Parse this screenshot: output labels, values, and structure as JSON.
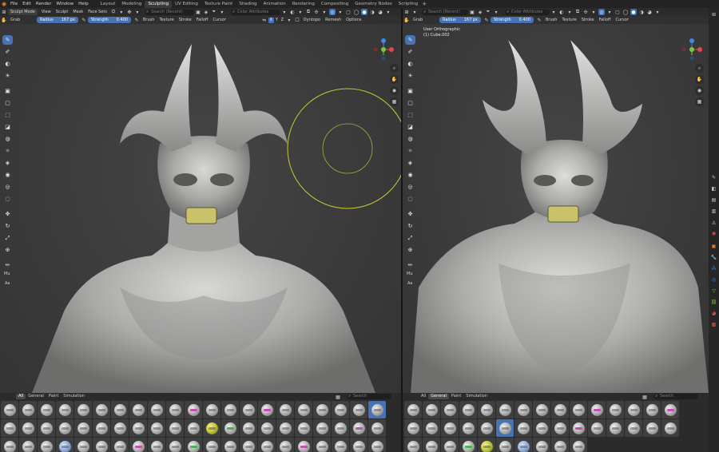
{
  "topbar": {
    "menus": [
      "File",
      "Edit",
      "Render",
      "Window",
      "Help"
    ],
    "workspaces": [
      "Layout",
      "Modeling",
      "Sculpting",
      "UV Editing",
      "Texture Paint",
      "Shading",
      "Animation",
      "Rendering",
      "Compositing",
      "Geometry Nodes",
      "Scripting"
    ],
    "active_workspace": "Sculpting",
    "add_tab": "+"
  },
  "left": {
    "header1": {
      "mode": "Sculpt Mode",
      "menus": [
        "View",
        "Sculpt",
        "Mask",
        "Face Sets"
      ],
      "search_placeholder": "Search (Recent)",
      "color_attributes": "Color Attributes"
    },
    "header2": {
      "tool": "Grab",
      "radius_label": "Radius",
      "radius_value": "167 px",
      "strength_label": "Strength",
      "strength_value": "0.400",
      "menus": [
        "Brush",
        "Texture",
        "Stroke",
        "Falloff",
        "Cursor"
      ],
      "axes": [
        "X",
        "Y",
        "Z"
      ],
      "menus2": [
        "Dyntopo",
        "Remesh",
        "Options"
      ]
    },
    "tool_label": "Mu",
    "tool_label2": "Aa",
    "shelf": {
      "tabs": [
        "All",
        "General",
        "Paint",
        "Simulation"
      ],
      "active_tab": "All",
      "search_placeholder": "Search"
    }
  },
  "right": {
    "header1": {
      "search_placeholder": "Search (Recent)",
      "color_attributes": "Color Attributes"
    },
    "header2": {
      "tool": "Grab",
      "radius_label": "Radius",
      "radius_value": "167 px",
      "strength_label": "Strength",
      "strength_value": "0.400",
      "menus": [
        "Brush",
        "Texture",
        "Stroke",
        "Falloff",
        "Cursor"
      ]
    },
    "overlay": {
      "view_name": "User Orthographic",
      "object_name": "(1) Cube.002"
    },
    "tool_label": "Mu",
    "tool_label2": "Aa",
    "shelf": {
      "tabs": [
        "All",
        "General",
        "Paint",
        "Simulation"
      ],
      "active_tab": "General",
      "search_placeholder": "Search"
    }
  },
  "gizmo": {
    "x": "X",
    "y": "Y",
    "z": "Z"
  },
  "colors": {
    "accent": "#4772b3",
    "brush_circle": "#c8c832",
    "x_axis": "#e5454e",
    "y_axis": "#7ec73d",
    "z_axis": "#3f87e8",
    "blender_orange": "#e8862f"
  }
}
